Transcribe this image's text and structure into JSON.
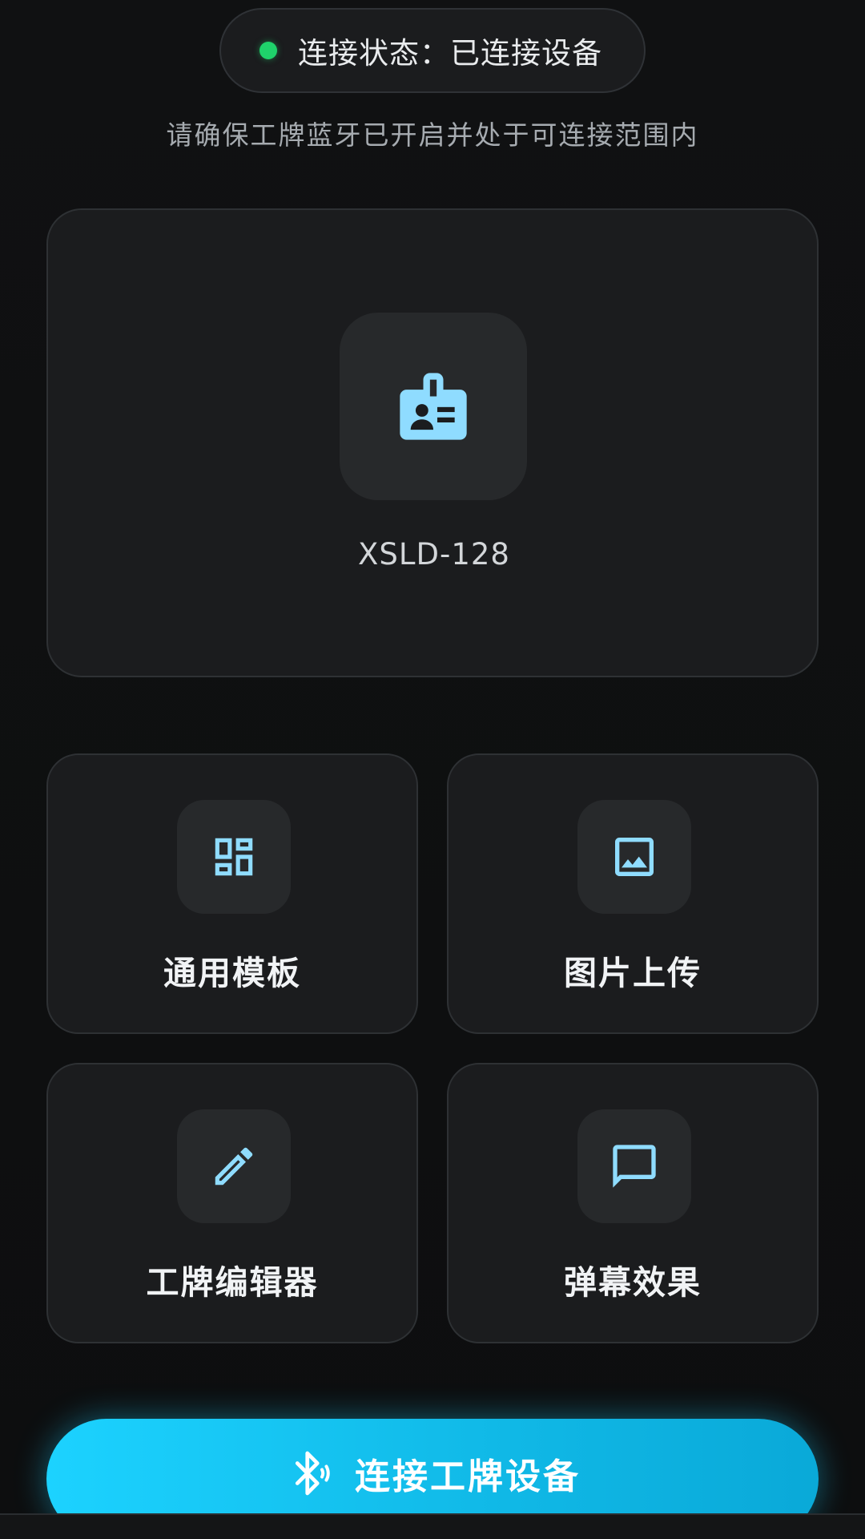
{
  "status": {
    "label": "连接状态：已连接设备",
    "dot_color": "#1fd36b"
  },
  "hint": "请确保工牌蓝牙已开启并处于可连接范围内",
  "device": {
    "name": "XSLD-128",
    "icon": "badge-icon"
  },
  "features": [
    {
      "label": "通用模板",
      "icon": "template-grid-icon"
    },
    {
      "label": "图片上传",
      "icon": "image-icon"
    },
    {
      "label": "工牌编辑器",
      "icon": "pencil-icon"
    },
    {
      "label": "弹幕效果",
      "icon": "chat-bubble-icon"
    }
  ],
  "connect_button": {
    "label": "连接工牌设备",
    "icon": "bluetooth-icon"
  },
  "colors": {
    "accent": "#17c6f2",
    "icon_tint": "#8fdcff"
  }
}
